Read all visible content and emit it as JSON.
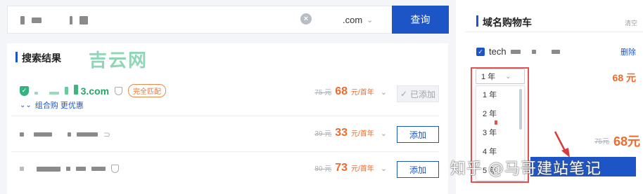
{
  "search": {
    "tld": ".com",
    "clear_icon": "close-circle-icon",
    "query_label": "查询"
  },
  "results": {
    "title": "搜索结果",
    "brand_logo": "吉云网",
    "rows": [
      {
        "domain_suffix": "3.com",
        "badge": "完全匹配",
        "combo": "组合购 更优惠",
        "old_price": "75 元",
        "price": "68",
        "unit": "元/首年",
        "action": "已添加",
        "added": true
      },
      {
        "old_price": "39 元",
        "price": "33",
        "unit": "元/首年",
        "action": "添加",
        "added": false
      },
      {
        "old_price": "80 元",
        "price": "73",
        "unit": "元/首年",
        "action": "添加",
        "added": false
      }
    ]
  },
  "cart": {
    "title": "域名购物车",
    "clear": "清空",
    "item_domain": "tech",
    "delete": "删除",
    "item_price": "68 元",
    "year_selected": "1 年",
    "year_options": [
      "1 年",
      "2 年",
      "3 年",
      "4 年",
      "5 年"
    ],
    "total_old": "75元",
    "total_new": "68元"
  },
  "watermark": "知乎 @马哥建站笔记",
  "colors": {
    "primary": "#1e55c6",
    "price": "#ee6a2d",
    "success": "#2aa36a",
    "highlight": "#e55050"
  }
}
